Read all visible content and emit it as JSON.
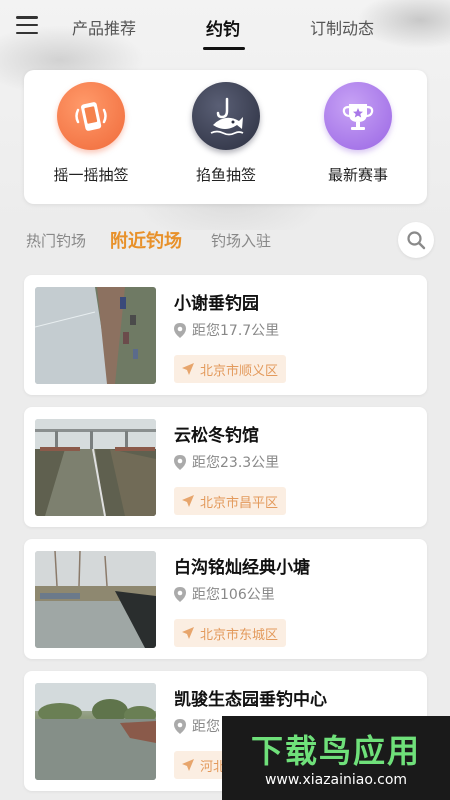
{
  "header": {
    "tabs": [
      {
        "label": "产品推荐"
      },
      {
        "label": "约钓"
      },
      {
        "label": "订制动态"
      }
    ]
  },
  "features": [
    {
      "label": "摇一摇抽签",
      "icon": "phone-shake-icon"
    },
    {
      "label": "掐鱼抽签",
      "icon": "fish-hook-icon"
    },
    {
      "label": "最新赛事",
      "icon": "trophy-icon"
    }
  ],
  "filters": {
    "tabs": [
      {
        "label": "热门钓场"
      },
      {
        "label": "附近钓场"
      },
      {
        "label": "钓场入驻"
      }
    ],
    "active": "附近钓场"
  },
  "spots": [
    {
      "name": "小谢垂钓园",
      "distance": "距您17.7公里",
      "area": "北京市顺义区"
    },
    {
      "name": "云松冬钓馆",
      "distance": "距您23.3公里",
      "area": "北京市昌平区"
    },
    {
      "name": "白沟铭灿经典小塘",
      "distance": "距您106公里",
      "area": "北京市东城区"
    },
    {
      "name": "凯骏生态园垂钓中心",
      "distance": "距您",
      "area": "河北"
    }
  ],
  "watermark": {
    "title": "下载鸟应用",
    "url": "www.xiazainiao.com"
  },
  "colors": {
    "accent": "#e8912a",
    "area_bg": "#fbeee2",
    "area_text": "#e39a5c"
  }
}
